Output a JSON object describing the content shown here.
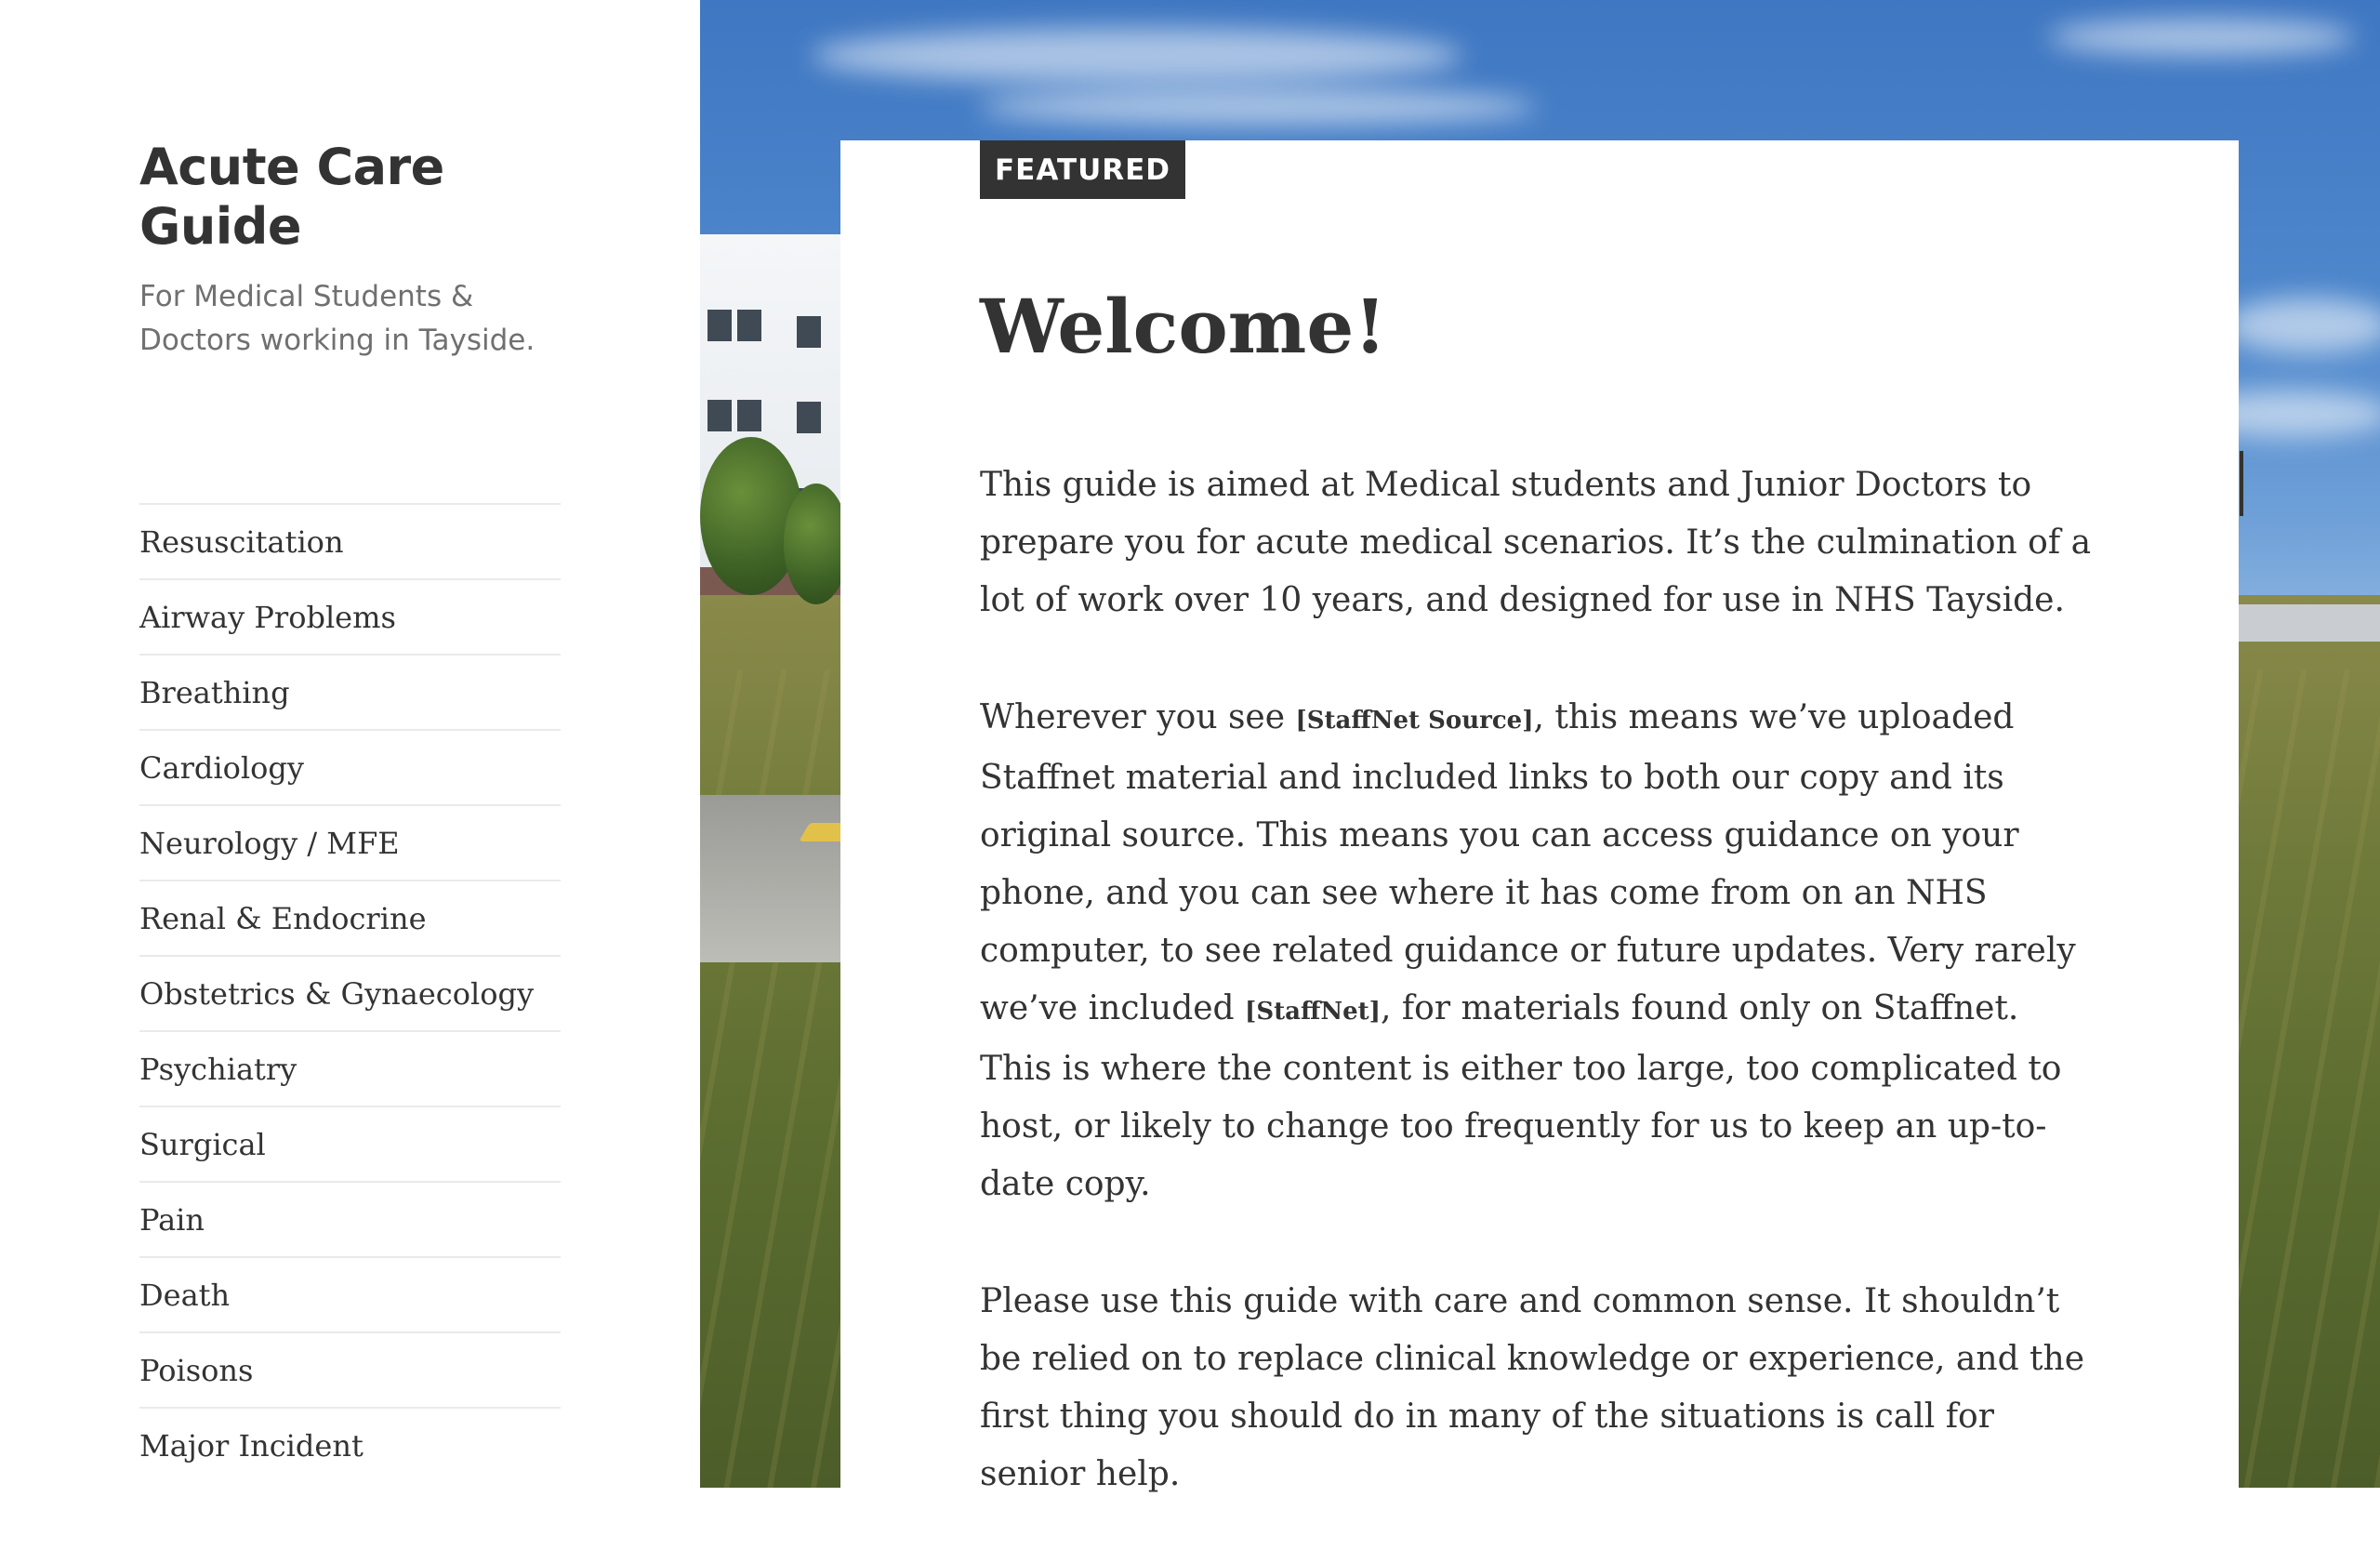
{
  "site": {
    "title": "Acute Care Guide",
    "description": "For Medical Students & Doctors working in Tayside."
  },
  "nav": {
    "items": [
      {
        "label": "Resuscitation"
      },
      {
        "label": "Airway Problems"
      },
      {
        "label": "Breathing"
      },
      {
        "label": "Cardiology"
      },
      {
        "label": "Neurology / MFE"
      },
      {
        "label": "Renal & Endocrine"
      },
      {
        "label": "Obstetrics & Gynaecology"
      },
      {
        "label": "Psychiatry"
      },
      {
        "label": "Surgical"
      },
      {
        "label": "Pain"
      },
      {
        "label": "Death"
      },
      {
        "label": "Poisons"
      },
      {
        "label": "Major Incident"
      }
    ]
  },
  "article": {
    "badge": "FEATURED",
    "title": "Welcome!",
    "p1": "This guide is aimed at Medical students and Junior Doctors to prepare you for acute medical scenarios. It’s the culmination of a lot of work over 10 years, and designed for use in NHS Tayside.",
    "p2_a": "Wherever you see ",
    "p2_tag1": "[StaffNet Source]",
    "p2_b": ", this means we’ve uploaded Staffnet material and included links to both our copy and its original source. This means you can access guidance on your phone, and you can see where it has come from on an NHS computer, to see related guidance or future updates. Very rarely we’ve included ",
    "p2_tag2": "[StaffNet]",
    "p2_c": ", for materials found only on Staffnet. This is where the content is either too large, too complicated to host, or likely to change too frequently for us to keep an up-to-date copy.",
    "p3": "Please use this guide with care and common sense. It shouldn’t be relied on to replace clinical knowledge or experience, and the first thing you should do in many of the situations is call for senior help."
  }
}
